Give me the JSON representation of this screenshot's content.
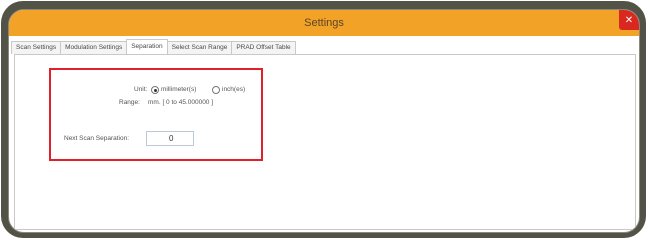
{
  "window": {
    "title": "Settings",
    "close_glyph": "✕"
  },
  "tabs": [
    {
      "label": "Scan Settings"
    },
    {
      "label": "Modulation Settings"
    },
    {
      "label": "Separation"
    },
    {
      "label": "Select Scan Range"
    },
    {
      "label": "PRAD Offset Table"
    }
  ],
  "separation": {
    "unit_label": "Unit:",
    "unit_options": [
      "millimeter(s)",
      "inch(es)"
    ],
    "unit_selected": "millimeter(s)",
    "range_label": "Range:",
    "range_value": "mm. [ 0 to 45.000000 ]",
    "next_scan_label": "Next Scan Separation:",
    "next_scan_value": "0"
  },
  "colors": {
    "frame": "#525246",
    "titlebar": "#f2a227",
    "highlight": "#e0202a",
    "close": "#d8281f"
  }
}
